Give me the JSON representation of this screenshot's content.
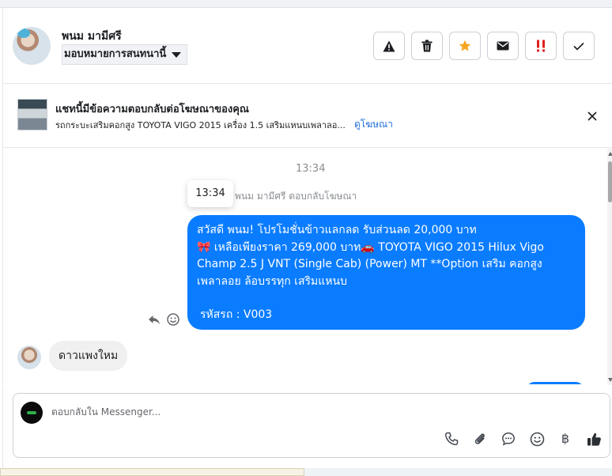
{
  "header": {
    "user_name": "พนม มามีศรี",
    "assign_label": "มอบหมายการสนทนานี้",
    "actions": [
      {
        "id": "spam",
        "icon": "warning-icon"
      },
      {
        "id": "delete",
        "icon": "trash-icon"
      },
      {
        "id": "star",
        "icon": "star-icon"
      },
      {
        "id": "mark-unread",
        "icon": "envelope-icon"
      },
      {
        "id": "priority",
        "icon": "double-exclamation-icon"
      },
      {
        "id": "done",
        "icon": "checkmark-icon"
      }
    ]
  },
  "ad_banner": {
    "title": "แชทนี้มีข้อความตอบกลับต่อโฆษณาของคุณ",
    "description": "รถกระบะเสริมคอกสูง TOYOTA VIGO 2015 เครื่อง 1.5 เสริมแหนบเพลาลอ...",
    "link": "ดูโฆษณา"
  },
  "thread": {
    "timestamp": "13:34",
    "tooltip_time": "13:34",
    "reply_note": "พนม มามีศรี ตอบกลับโฆษณา",
    "outgoing_message": {
      "line1": "สวัสดี พนม!  โปรโมชั่นข้าวแลกลด รับส่วนลด 20,000 บาท",
      "line2_emoji": "🎀",
      "line2": "  เหลือเพียงราคา 269,000 บาท",
      "line2_car": "🚗",
      "line2_tail": " TOYOTA VIGO 2015 Hilux Vigo",
      "line3": "Champ 2.5 J VNT (Single Cab) (Power) MT **Option เสริม คอกสูง",
      "line4": "เพลาลอย ล้อบรรทุก เสริมแหนบ",
      "line5": "รหัสรถ : V003"
    },
    "incoming_message": "ดาวแพงใหม"
  },
  "composer": {
    "placeholder": "ตอบกลับใน Messenger...",
    "baht_symbol": "฿"
  },
  "colors": {
    "bubble_out": "#0a7cff",
    "bubble_in": "#f0f0f0",
    "star": "#f5a623",
    "priority": "#e02020",
    "link": "#216fdb"
  }
}
